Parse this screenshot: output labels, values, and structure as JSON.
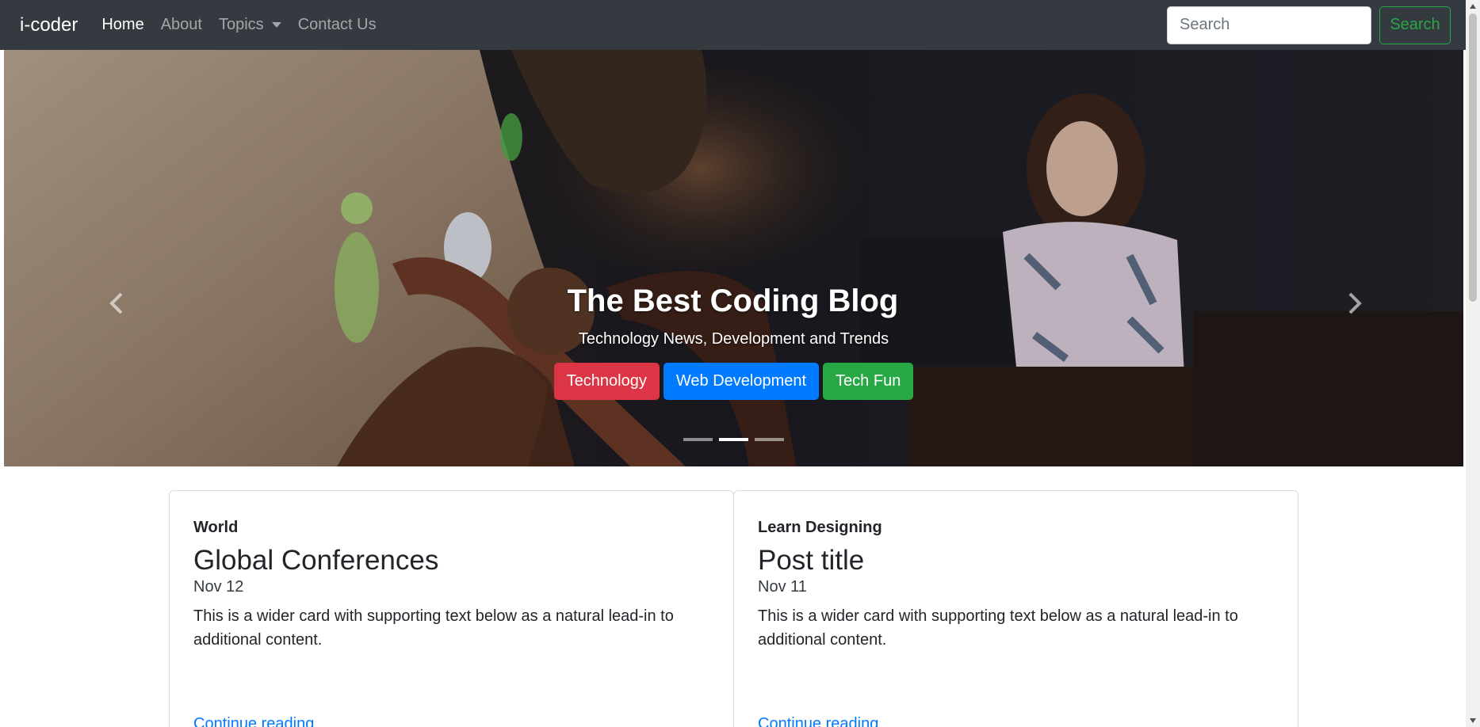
{
  "navbar": {
    "brand": "i-coder",
    "links": [
      {
        "label": "Home",
        "active": true
      },
      {
        "label": "About",
        "active": false
      },
      {
        "label": "Topics",
        "active": false,
        "dropdown": true
      },
      {
        "label": "Contact Us",
        "active": false
      }
    ],
    "search_placeholder": "Search",
    "search_button": "Search"
  },
  "hero": {
    "title": "The Best Coding Blog",
    "subtitle": "Technology News, Development and Trends",
    "buttons": [
      {
        "label": "Technology",
        "color": "#dc3545"
      },
      {
        "label": "Web Development",
        "color": "#007bff"
      },
      {
        "label": "Tech Fun",
        "color": "#28a745"
      }
    ],
    "indicators": 3,
    "active_indicator": 1
  },
  "cards": [
    {
      "category": "World",
      "title": "Global Conferences",
      "date": "Nov 12",
      "text": "This is a wider card with supporting text below as a natural lead-in to additional content.",
      "link": "Continue reading"
    },
    {
      "category": "Learn Designing",
      "title": "Post title",
      "date": "Nov 11",
      "text": "This is a wider card with supporting text below as a natural lead-in to additional content.",
      "link": "Continue reading"
    }
  ],
  "colors": {
    "navbar_bg": "#343a40",
    "success": "#28a745",
    "link": "#007bff"
  }
}
